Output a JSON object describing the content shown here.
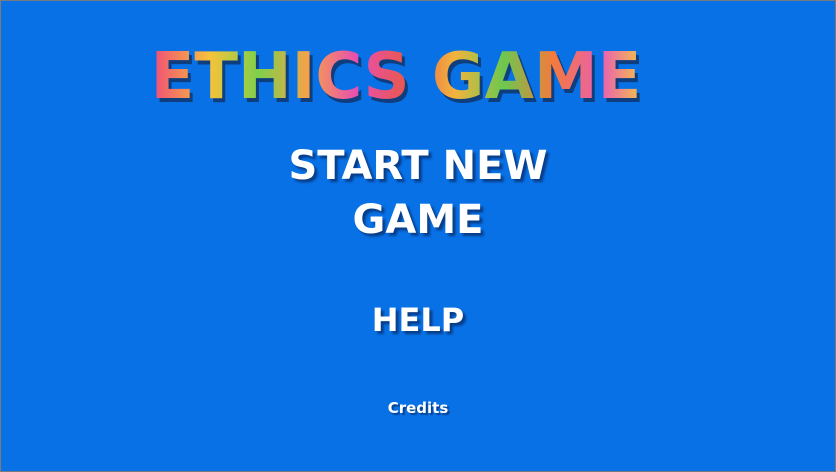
{
  "game": {
    "title": "ETHICS GAME",
    "start_line1": "START NEW",
    "start_line2": "GAME",
    "help_label": "HELP",
    "credits_label": "Credits"
  },
  "colors": {
    "background": "#0871e6",
    "button_text": "#ffffff",
    "title_gradient": [
      "#f04a7a",
      "#f7c23a",
      "#7fd04a",
      "#f5a24a",
      "#e94fb0",
      "#e8584e",
      "#f3b33c",
      "#6cc84f",
      "#f47a3c"
    ]
  }
}
